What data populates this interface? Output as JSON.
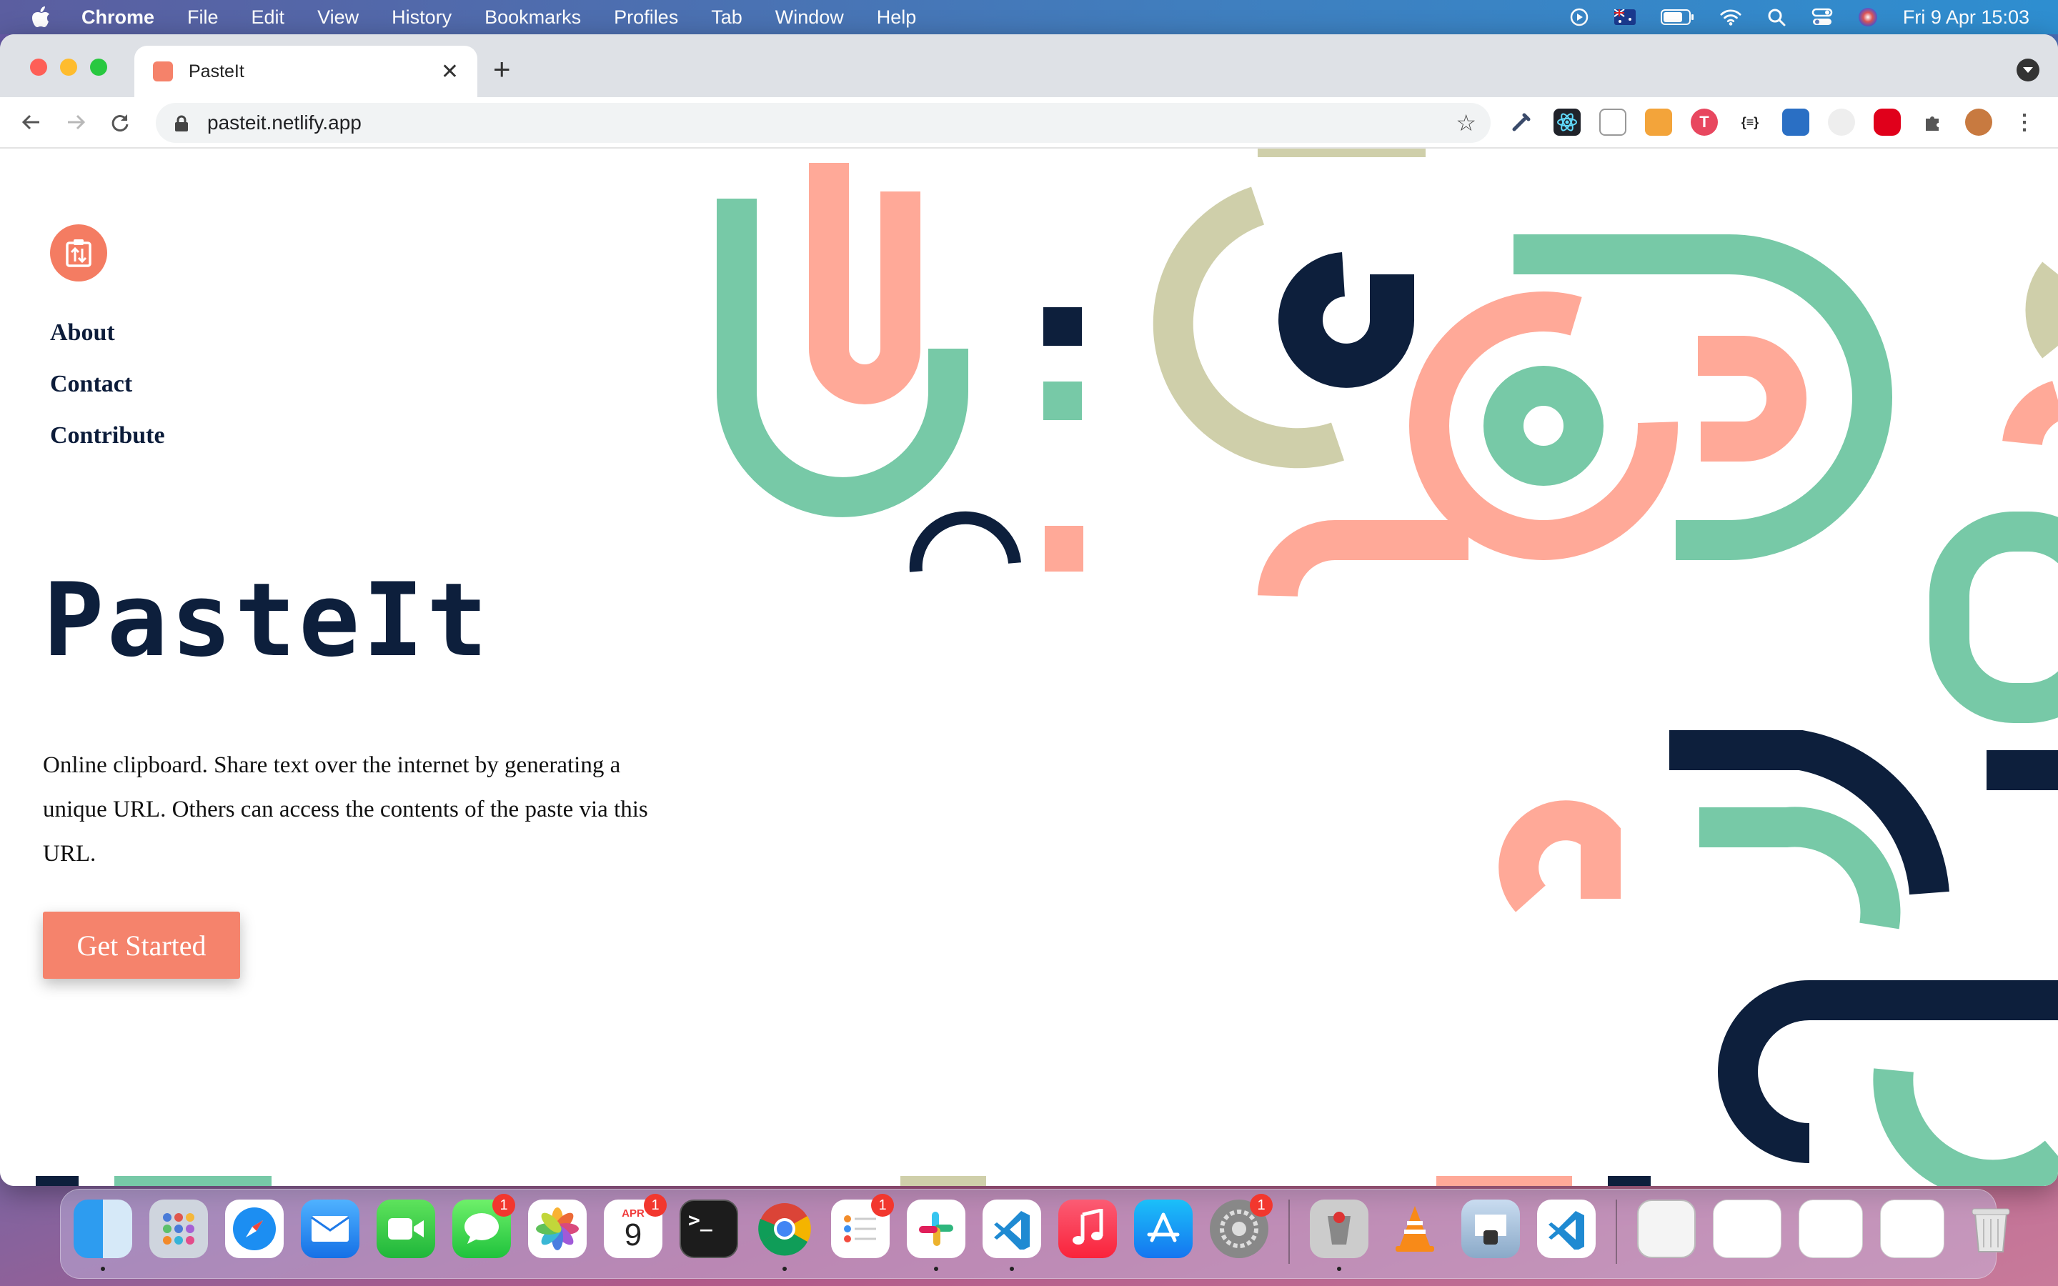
{
  "menubar": {
    "app": "Chrome",
    "items": [
      "File",
      "Edit",
      "View",
      "History",
      "Bookmarks",
      "Profiles",
      "Tab",
      "Window",
      "Help"
    ],
    "clock": "Fri 9 Apr  15:03"
  },
  "browser": {
    "tab_title": "PasteIt",
    "url": "pasteit.netlify.app"
  },
  "site": {
    "nav": [
      "About",
      "Contact",
      "Contribute"
    ],
    "brand": "PasteIt",
    "description": "Online clipboard. Share text over the internet by generating a unique URL. Others can access the contents of the paste via this URL.",
    "cta": "Get Started"
  },
  "colors": {
    "navy": "#0d1f3c",
    "green": "#77c9a7",
    "salmon": "#ffa998",
    "khaki": "#cfcfaa",
    "accent": "#f5836c"
  },
  "dock": {
    "calendar_month": "APR",
    "calendar_day": "9",
    "badges": {
      "messages": "1",
      "calendar": "1",
      "reminders": "1",
      "settings": "1"
    }
  }
}
